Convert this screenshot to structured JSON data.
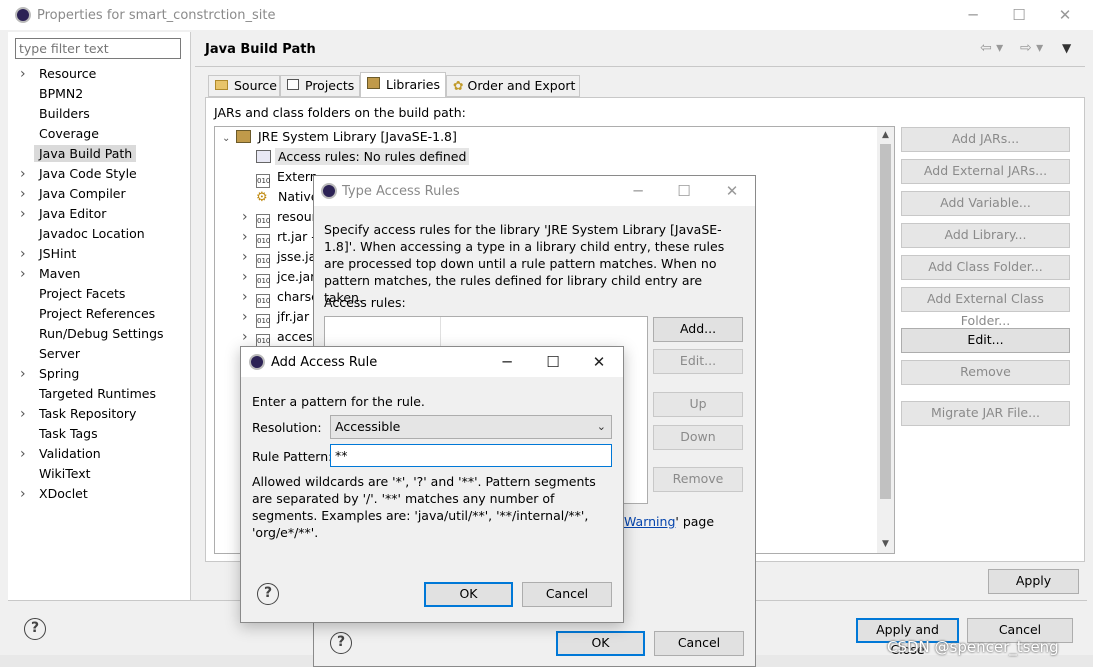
{
  "main_window": {
    "title": "Properties for smart_constrction_site",
    "filter_placeholder": "type filter text",
    "nav_items": [
      {
        "label": "Resource",
        "expandable": true
      },
      {
        "label": "BPMN2",
        "expandable": false
      },
      {
        "label": "Builders",
        "expandable": false
      },
      {
        "label": "Coverage",
        "expandable": false
      },
      {
        "label": "Java Build Path",
        "expandable": false,
        "selected": true
      },
      {
        "label": "Java Code Style",
        "expandable": true
      },
      {
        "label": "Java Compiler",
        "expandable": true
      },
      {
        "label": "Java Editor",
        "expandable": true
      },
      {
        "label": "Javadoc Location",
        "expandable": false
      },
      {
        "label": "JSHint",
        "expandable": true
      },
      {
        "label": "Maven",
        "expandable": true
      },
      {
        "label": "Project Facets",
        "expandable": false
      },
      {
        "label": "Project References",
        "expandable": false
      },
      {
        "label": "Run/Debug Settings",
        "expandable": false
      },
      {
        "label": "Server",
        "expandable": false
      },
      {
        "label": "Spring",
        "expandable": true
      },
      {
        "label": "Targeted Runtimes",
        "expandable": false
      },
      {
        "label": "Task Repository",
        "expandable": true
      },
      {
        "label": "Task Tags",
        "expandable": false
      },
      {
        "label": "Validation",
        "expandable": true
      },
      {
        "label": "WikiText",
        "expandable": false
      },
      {
        "label": "XDoclet",
        "expandable": true
      }
    ],
    "page_title": "Java Build Path",
    "tabs": [
      {
        "label": "Source"
      },
      {
        "label": "Projects"
      },
      {
        "label": "Libraries",
        "active": true
      },
      {
        "label": "Order and Export"
      }
    ],
    "jars_label": "JARs and class folders on the build path:",
    "tree": [
      {
        "label": "JRE System Library [JavaSE-1.8]",
        "level": 0,
        "expanded": true
      },
      {
        "label": "Access rules: No rules defined",
        "level": 1,
        "selected": true
      },
      {
        "label": "Extern",
        "level": 1
      },
      {
        "label": "Native",
        "level": 1
      },
      {
        "label": "resour",
        "level": 1,
        "expandable": true
      },
      {
        "label": "rt.jar -",
        "level": 1,
        "expandable": true
      },
      {
        "label": "jsse.ja",
        "level": 1,
        "expandable": true
      },
      {
        "label": "jce.jar",
        "level": 1,
        "expandable": true
      },
      {
        "label": "charse",
        "level": 1,
        "expandable": true
      },
      {
        "label": "jfr.jar",
        "level": 1,
        "expandable": true
      },
      {
        "label": "access",
        "level": 1,
        "expandable": true
      }
    ],
    "side_buttons": {
      "add_jars": "Add JARs...",
      "add_external_jars": "Add External JARs...",
      "add_variable": "Add Variable...",
      "add_library": "Add Library...",
      "add_class_folder": "Add Class Folder...",
      "add_external_class_folder": "Add External Class Folder...",
      "edit": "Edit...",
      "remove": "Remove",
      "migrate_jar": "Migrate JAR File..."
    },
    "apply": "Apply",
    "apply_and_close": "Apply and Close",
    "cancel": "Cancel"
  },
  "type_access_rules": {
    "title": "Type Access Rules",
    "description": "Specify access rules for the library 'JRE System Library [JavaSE-1.8]'. When accessing a type in a library child entry, these rules are processed top down until a rule pattern matches. When no pattern matches, the rules defined for library child entry are taken.",
    "access_rules_label": "Access rules:",
    "buttons": {
      "add": "Add...",
      "edit": "Edit...",
      "up": "Up",
      "down": "Down",
      "remove": "Remove"
    },
    "warning_link": "Warning",
    "page_suffix": "' page",
    "ok": "OK",
    "cancel": "Cancel"
  },
  "add_access_rule": {
    "title": "Add Access Rule",
    "prompt": "Enter a pattern for the rule.",
    "resolution_label": "Resolution:",
    "resolution_value": "Accessible",
    "rule_pattern_label": "Rule Pattern:",
    "rule_pattern_value": "**",
    "help_text": "Allowed wildcards are '*', '?' and '**'. Pattern segments are separated by '/'. '**' matches any number of segments. Examples are: 'java/util/**', '**/internal/**', 'org/e*/**'.",
    "ok": "OK",
    "cancel": "Cancel"
  },
  "watermark": "CSDN @spencer_tseng"
}
